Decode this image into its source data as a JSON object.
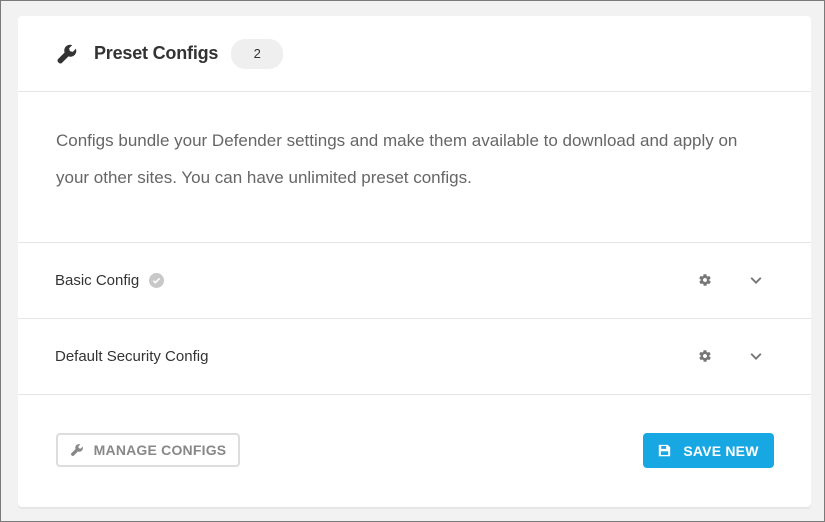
{
  "header": {
    "title": "Preset Configs",
    "count": "2",
    "icon": "wrench-icon"
  },
  "description": "Configs bundle your Defender settings and make them available to download and apply on your other sites. You can have unlimited preset configs.",
  "configs": [
    {
      "name": "Basic Config",
      "active": true
    },
    {
      "name": "Default Security Config",
      "active": false
    }
  ],
  "footer": {
    "manage_label": "MANAGE CONFIGS",
    "save_label": "SAVE NEW"
  },
  "colors": {
    "accent": "#17a8e3",
    "background": "#f2f2f2"
  }
}
